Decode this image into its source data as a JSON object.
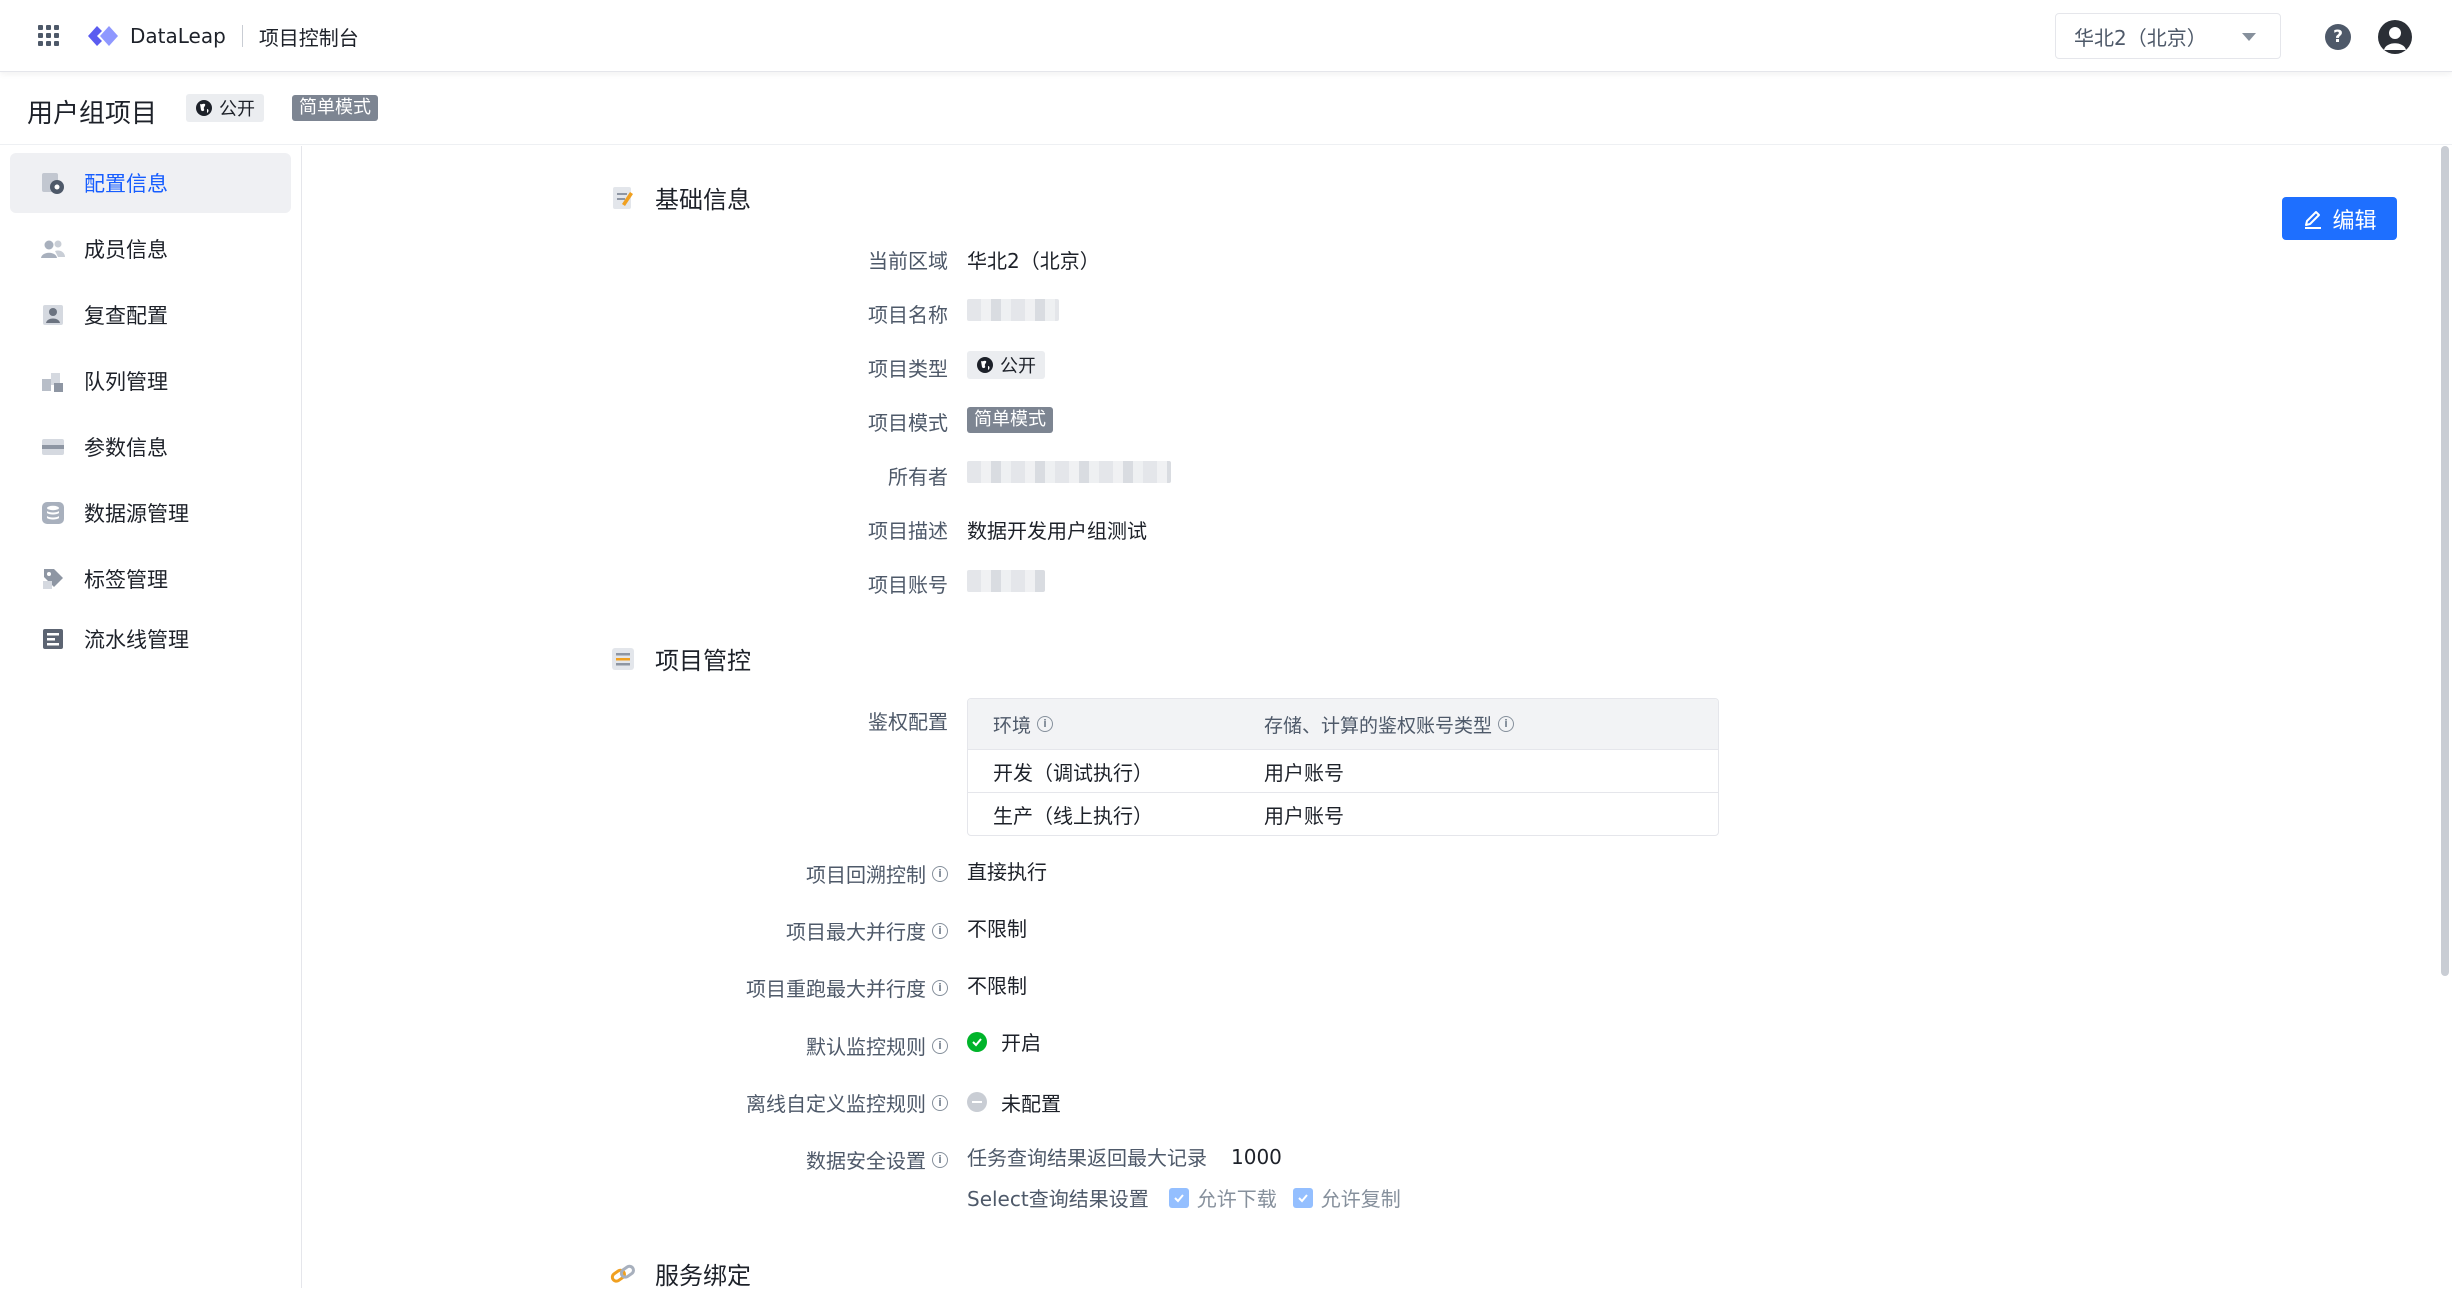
{
  "topbar": {
    "brand": "DataLeap",
    "console": "项目控制台",
    "region": "华北2（北京）",
    "help_icon": "question-circle-icon",
    "user_icon": "user-avatar-icon"
  },
  "project": {
    "title": "用户组项目",
    "visibility": "公开",
    "mode": "简单模式"
  },
  "sidebar": {
    "items": [
      {
        "label": "配置信息",
        "icon": "gear-doc-icon",
        "active": true
      },
      {
        "label": "成员信息",
        "icon": "users-icon"
      },
      {
        "label": "复查配置",
        "icon": "reviewer-icon"
      },
      {
        "label": "队列管理",
        "icon": "queue-blocks-icon"
      },
      {
        "label": "参数信息",
        "icon": "params-card-icon"
      },
      {
        "label": "数据源管理",
        "icon": "database-icon"
      },
      {
        "label": "标签管理",
        "icon": "tag-icon"
      },
      {
        "label": "流水线管理",
        "icon": "pipeline-icon"
      }
    ]
  },
  "main": {
    "edit_label": "编辑",
    "basic": {
      "title": "基础信息",
      "region_label": "当前区域",
      "region_value": "华北2（北京）",
      "name_label": "项目名称",
      "type_label": "项目类型",
      "type_value": "公开",
      "mode_label": "项目模式",
      "mode_value": "简单模式",
      "owner_label": "所有者",
      "desc_label": "项目描述",
      "desc_value": "数据开发用户组测试",
      "account_label": "项目账号"
    },
    "control": {
      "title": "项目管控",
      "auth_label": "鉴权配置",
      "auth_table": {
        "headers": [
          "环境",
          "存储、计算的鉴权账号类型"
        ],
        "rows": [
          [
            "开发（调试执行）",
            "用户账号"
          ],
          [
            "生产（线上执行）",
            "用户账号"
          ]
        ]
      },
      "backtrack_label": "项目回溯控制",
      "backtrack_value": "直接执行",
      "max_parallel_label": "项目最大并行度",
      "max_parallel_value": "不限制",
      "rerun_parallel_label": "项目重跑最大并行度",
      "rerun_parallel_value": "不限制",
      "default_monitor_label": "默认监控规则",
      "default_monitor_value": "开启",
      "offline_monitor_label": "离线自定义监控规则",
      "offline_monitor_value": "未配置",
      "security_label": "数据安全设置",
      "security_max_records_label": "任务查询结果返回最大记录",
      "security_max_records_value": "1000",
      "select_setting_label": "Select查询结果设置",
      "allow_download": "允许下载",
      "allow_copy": "允许复制"
    },
    "binding": {
      "title": "服务绑定"
    }
  },
  "colors": {
    "primary": "#1e6fff",
    "success": "#00b42a",
    "mode_tag": "#7d8592"
  }
}
